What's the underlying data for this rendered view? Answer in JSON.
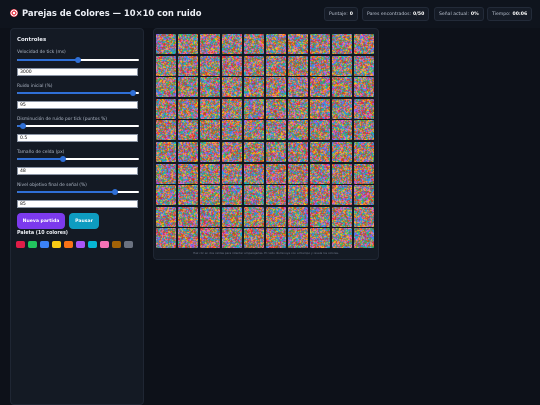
{
  "header": {
    "title": "Parejas de Colores — 10×10 con ruido",
    "icon": "target-icon"
  },
  "stats": {
    "score_label": "Puntaje:",
    "score_value": "0",
    "pairs_label": "Pares encontrados:",
    "pairs_value": "0/50",
    "signal_label": "Señal actual:",
    "signal_value": "0%",
    "time_label": "Tiempo:",
    "time_value": "00:06"
  },
  "controls": {
    "title": "Controles",
    "tick_speed": {
      "label": "Velocidad de tick (ms)",
      "value": "3000",
      "slider_fraction": 0.5
    },
    "initial_noise": {
      "label": "Ruido inicial (%)",
      "value": "95",
      "slider_fraction": 0.95
    },
    "noise_decrease": {
      "label": "Disminución de ruido por tick (puntos %)",
      "value": "0.5",
      "slider_fraction": 0.05
    },
    "cell_size": {
      "label": "Tamaño de celda (px)",
      "value": "48",
      "slider_fraction": 0.38
    },
    "final_signal": {
      "label": "Nivel objetivo final de señal (%)",
      "value": "85",
      "slider_fraction": 0.8
    },
    "new_game_label": "Nueva partida",
    "pause_label": "Pausar"
  },
  "palette": {
    "title": "Paleta (10 colores)",
    "colors": [
      "#e11d48",
      "#22c55e",
      "#3b82f6",
      "#facc15",
      "#f97316",
      "#a855f7",
      "#06b6d4",
      "#f472b6",
      "#a16207",
      "#6b7280"
    ]
  },
  "board": {
    "rows": 10,
    "cols": 10,
    "hint": "Haz clic en dos celdas para intentar emparejarlas. El ruido disminuye con el tiempo y revela los colores."
  }
}
